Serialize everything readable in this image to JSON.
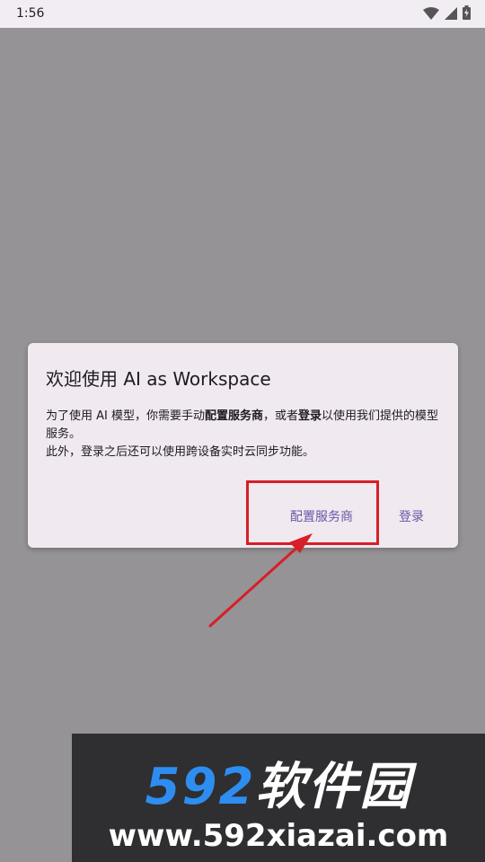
{
  "status_bar": {
    "time": "1:56",
    "icons": [
      "wifi-icon",
      "signal-icon",
      "battery-icon"
    ]
  },
  "dialog": {
    "title": "欢迎使用 AI as Workspace",
    "body": {
      "line1_part1": "为了使用 AI 模型，你需要手动",
      "line1_bold1": "配置服务商",
      "line1_part2": "，或者",
      "line1_bold2": "登录",
      "line1_part3": "以使用我们提供的模型服务。",
      "line2": "此外，登录之后还可以使用跨设备实时云同步功能。"
    },
    "buttons": {
      "config": "配置服务商",
      "login": "登录"
    }
  },
  "annotation": {
    "highlight_color": "#d61f26"
  },
  "watermark": {
    "logo_number": "592",
    "logo_text": "软件园",
    "url": "www.592xiazai.com"
  },
  "colors": {
    "scrim": "#959395",
    "dialog_bg": "#f0e9ef",
    "button_text": "#6a55a8",
    "watermark_bg": "#2f2e30",
    "watermark_accent": "#2e8df0"
  }
}
